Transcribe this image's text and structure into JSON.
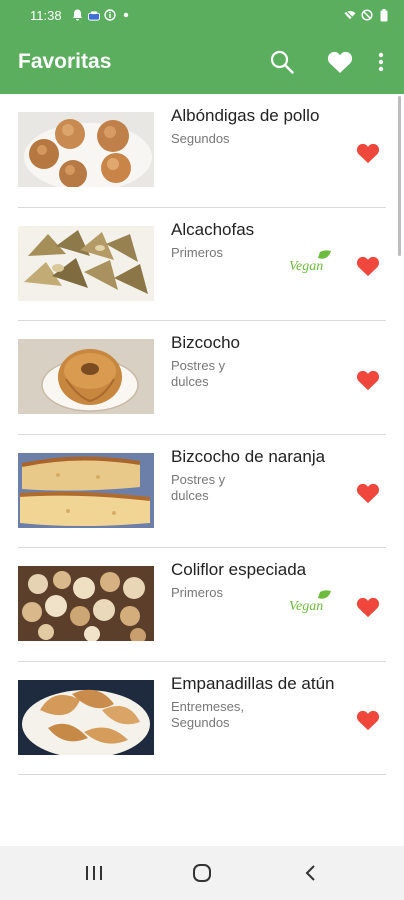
{
  "status_bar": {
    "time": "11:38",
    "left_icons": [
      "notification-bell-icon",
      "cloud-icon",
      "info-icon",
      "dot-icon"
    ],
    "right_icons": [
      "wifi-icon",
      "do-not-disturb-icon",
      "battery-icon"
    ]
  },
  "app_bar": {
    "title": "Favoritas",
    "actions": [
      "search-icon",
      "heart-icon",
      "more-vert-icon"
    ]
  },
  "recipes": [
    {
      "title": "Albóndigas de pollo",
      "category": "Segundos",
      "vegan": false,
      "favorite": true,
      "image": "meatballs-photo"
    },
    {
      "title": "Alcachofas",
      "category": "Primeros",
      "vegan": true,
      "favorite": true,
      "image": "artichokes-photo"
    },
    {
      "title": "Bizcocho",
      "category": "Postres y dulces",
      "vegan": false,
      "favorite": true,
      "image": "bundt-cake-photo"
    },
    {
      "title": "Bizcocho de naranja",
      "category": "Postres y dulces",
      "vegan": false,
      "favorite": true,
      "image": "orange-cake-photo"
    },
    {
      "title": "Coliflor especiada",
      "category": "Primeros",
      "vegan": true,
      "favorite": true,
      "image": "spiced-cauliflower-photo"
    },
    {
      "title": "Empanadillas de atún",
      "category": "Entremeses, Segundos",
      "vegan": false,
      "favorite": true,
      "image": "tuna-empanadillas-photo"
    }
  ],
  "vegan_badge": {
    "label": "Vegan",
    "color": "#6dbb3f"
  },
  "nav_bar": {
    "buttons": [
      "recent-apps-icon",
      "home-icon",
      "back-icon"
    ]
  },
  "colors": {
    "primary": "#5aae5e",
    "heart": "#f0473d",
    "title_text": "#222222",
    "category_text": "#777777"
  }
}
